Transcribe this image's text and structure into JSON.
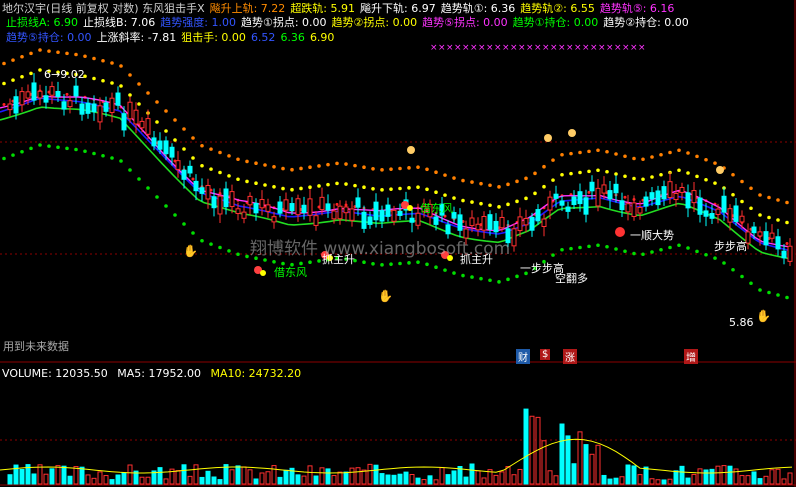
{
  "header": {
    "row1": [
      {
        "label": "地尔汉宇(日线 前复权 对数) 东风狙击手X",
        "color": "#d0d0d0"
      },
      {
        "label": "飚升上轨: 7.22",
        "color": "#ff8c00"
      },
      {
        "label": "超跌轨: 5.91",
        "color": "#ffff00"
      },
      {
        "label": "飚升下轨: 6.97",
        "color": "#ffffff"
      },
      {
        "label": "趋势轨①: 6.36",
        "color": "#ffffff"
      },
      {
        "label": "趋势轨②: 6.55",
        "color": "#ffff00"
      },
      {
        "label": "趋势轨⑤: 6.16",
        "color": "#ff33ff"
      }
    ],
    "row2": [
      {
        "label": "止损线A: 6.90",
        "color": "#00ff00"
      },
      {
        "label": "止损线B: 7.06",
        "color": "#ffffff"
      },
      {
        "label": "趋势强度: 1.00",
        "color": "#3355ff"
      },
      {
        "label": "趋势①拐点: 0.00",
        "color": "#ffffff"
      },
      {
        "label": "趋势②拐点: 0.00",
        "color": "#ffff00"
      },
      {
        "label": "趋势⑤拐点: 0.00",
        "color": "#ff33ff"
      },
      {
        "label": "趋势①持仓: 0.00",
        "color": "#00ff00"
      },
      {
        "label": "趋势②持仓: 0.00",
        "color": "#ffffff"
      }
    ],
    "row3": [
      {
        "label": "趋势⑤持仓: 0.00",
        "color": "#3355ff"
      },
      {
        "label": "上涨斜率: -7.81",
        "color": "#ffffff"
      },
      {
        "label": "狙击手: 0.00",
        "color": "#ffff00"
      },
      {
        "label": "6.52",
        "color": "#3355ff"
      },
      {
        "label": "6.36",
        "color": "#00ff00"
      },
      {
        "label": "6.90",
        "color": "#ffff00"
      }
    ]
  },
  "annotations": {
    "high_price": "6→9.02",
    "low_price": "5.86",
    "watermark": "翔博软件 www.xiangbosoft.com",
    "future_data": "用到未来数据",
    "signals": [
      {
        "key": "jie1",
        "text": "借东风",
        "color": "#00ff00"
      },
      {
        "key": "jie2",
        "text": "借东风",
        "color": "#00ff00"
      },
      {
        "key": "zhu1",
        "text": "抓主升",
        "color": "#ffffff"
      },
      {
        "key": "zhu2",
        "text": "抓主升",
        "color": "#ffffff"
      },
      {
        "key": "bu1",
        "text": "一步步高",
        "color": "#ffffff"
      },
      {
        "key": "bu2",
        "text": "步步高",
        "color": "#ffffff"
      },
      {
        "key": "kong",
        "text": "空翻多",
        "color": "#ffffff"
      },
      {
        "key": "shun",
        "text": "一顺大势",
        "color": "#ffffff"
      }
    ]
  },
  "badges": [
    {
      "text": "财",
      "color": "#1e5aa8"
    },
    {
      "text": "$",
      "color": "#b01818"
    },
    {
      "text": "涨",
      "color": "#b01818"
    },
    {
      "text": "增",
      "color": "#b01818"
    }
  ],
  "volume": {
    "vol": "VOLUME: 12035.50",
    "ma5": "MA5: 17952.00",
    "ma10": "MA10: 24732.20",
    "vol_color": "#ffffff",
    "ma5_color": "#ffffff",
    "ma10_color": "#ffff00"
  },
  "colors": {
    "up": "#ff3030",
    "down": "#00ffff",
    "ma_blue": "#1a1aff",
    "ma_green": "#22dd22",
    "ma_magenta": "#ff33ff",
    "orange_dots": "#ff7f00",
    "yellow_dots": "#ffff00",
    "green_dots": "#00dd00",
    "red_dots": "#ff2020",
    "grid": "#8b0000"
  }
}
